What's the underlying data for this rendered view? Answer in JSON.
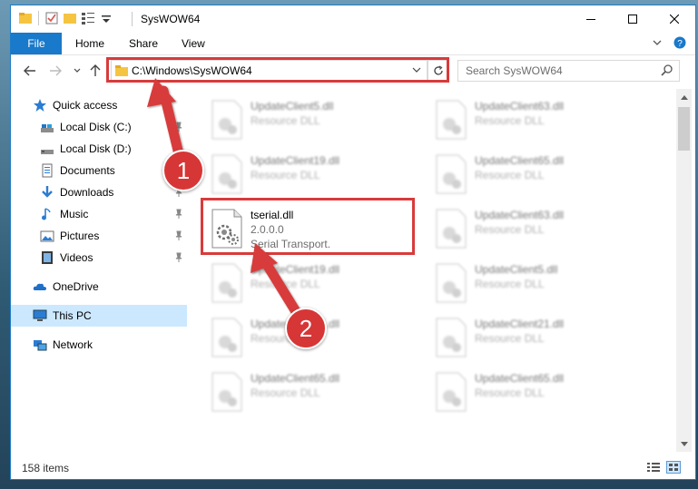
{
  "window": {
    "title": "SysWOW64",
    "minimize_label": "—",
    "maximize_label": "☐",
    "close_label": "✕"
  },
  "ribbon": {
    "tabs": [
      "File",
      "Home",
      "Share",
      "View"
    ],
    "expand_glyph": "⌄",
    "help_glyph": "?"
  },
  "nav": {
    "back_glyph": "←",
    "forward_glyph": "→",
    "recent_glyph": "⌄",
    "up_glyph": "↑",
    "address": "C:\\Windows\\SysWOW64",
    "address_drop_glyph": "⌄",
    "refresh_glyph": "↻",
    "search_placeholder": "Search SysWOW64"
  },
  "sidebar": {
    "items": [
      {
        "label": "Quick access",
        "icon": "star-icon"
      },
      {
        "label": "Local Disk (C:)",
        "icon": "drive-icon",
        "pinned": true
      },
      {
        "label": "Local Disk (D:)",
        "icon": "drive-icon",
        "pinned": true
      },
      {
        "label": "Documents",
        "icon": "documents-icon",
        "pinned": true
      },
      {
        "label": "Downloads",
        "icon": "download-icon",
        "pinned": true
      },
      {
        "label": "Music",
        "icon": "music-icon",
        "pinned": true
      },
      {
        "label": "Pictures",
        "icon": "pictures-icon",
        "pinned": true
      },
      {
        "label": "Videos",
        "icon": "videos-icon",
        "pinned": true
      },
      {
        "label": "OneDrive",
        "icon": "cloud-icon"
      },
      {
        "label": "This PC",
        "icon": "pc-icon",
        "selected": true
      },
      {
        "label": "Network",
        "icon": "network-icon"
      }
    ]
  },
  "files": {
    "left": [
      {
        "name": "UpdateClient5.dll",
        "desc": "Resource DLL"
      },
      {
        "name": "UpdateClient19.dll",
        "desc": "Resource DLL"
      },
      {
        "name": "tserial.dll",
        "version": "2.0.0.0",
        "desc": "Serial Transport."
      },
      {
        "name": "UpdateClient19.dll",
        "desc": "Resource DLL"
      },
      {
        "name": "UpdateClient65.dll",
        "desc": "Resource DLL"
      },
      {
        "name": "UpdateClient65.dll",
        "desc": "Resource DLL"
      }
    ],
    "right": [
      {
        "name": "UpdateClient63.dll",
        "desc": "Resource DLL"
      },
      {
        "name": "UpdateClient65.dll",
        "desc": "Resource DLL"
      },
      {
        "name": "UpdateClient63.dll",
        "desc": "Resource DLL"
      },
      {
        "name": "UpdateClient5.dll",
        "desc": "Resource DLL"
      },
      {
        "name": "UpdateClient21.dll",
        "desc": "Resource DLL"
      },
      {
        "name": "UpdateClient65.dll",
        "desc": "Resource DLL"
      }
    ]
  },
  "status": {
    "items_count": "158 items"
  },
  "callouts": {
    "step1": "1",
    "step2": "2"
  },
  "colors": {
    "accent": "#1979ca",
    "callout": "#d73636",
    "selection": "#cce8ff"
  }
}
